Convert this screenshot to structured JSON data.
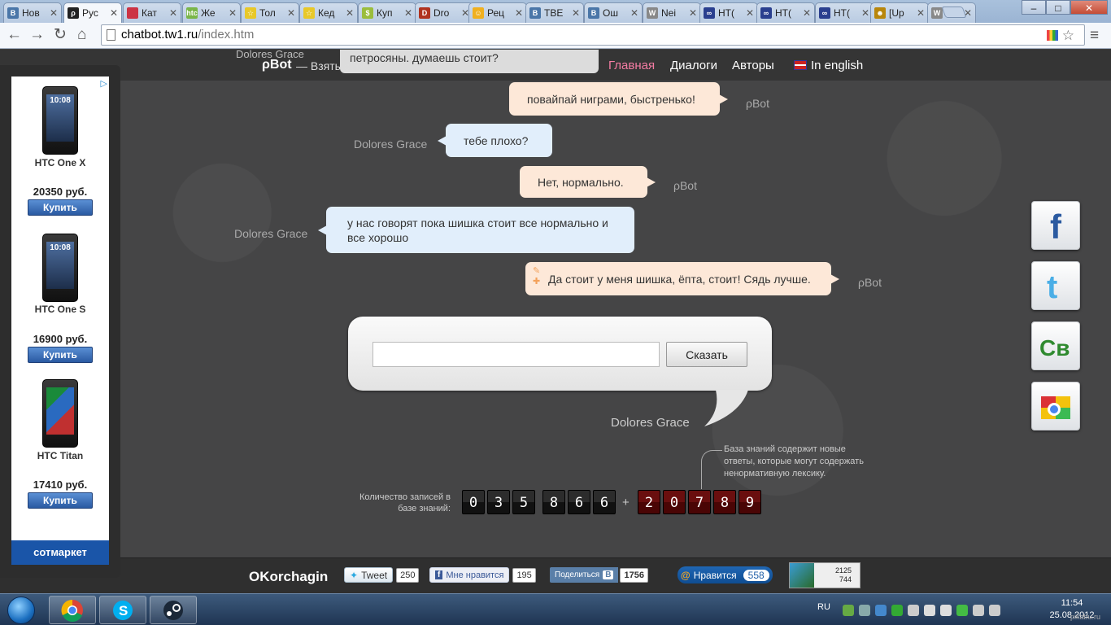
{
  "browser": {
    "tabs": [
      {
        "label": "Нов",
        "color": "#4a76a8",
        "glyph": "B"
      },
      {
        "label": "Рус",
        "color": "#222222",
        "glyph": "ρ"
      },
      {
        "label": "Кат",
        "color": "#cc3344",
        "glyph": ""
      },
      {
        "label": "Же",
        "color": "#7ab648",
        "glyph": "htc"
      },
      {
        "label": "Тол",
        "color": "#e8c829",
        "glyph": "☆"
      },
      {
        "label": "Кед",
        "color": "#e8c829",
        "glyph": "☆"
      },
      {
        "label": "Куп",
        "color": "#9bbd3c",
        "glyph": "$"
      },
      {
        "label": "Dro",
        "color": "#b0321f",
        "glyph": "D"
      },
      {
        "label": "Рец",
        "color": "#f0b020",
        "glyph": "☺"
      },
      {
        "label": "ТВЕ",
        "color": "#4a76a8",
        "glyph": "B"
      },
      {
        "label": "Ош",
        "color": "#4a76a8",
        "glyph": "B"
      },
      {
        "label": "Nei",
        "color": "#888888",
        "glyph": "W"
      },
      {
        "label": "HT(",
        "color": "#2a3f8f",
        "glyph": "∞"
      },
      {
        "label": "HT(",
        "color": "#2a3f8f",
        "glyph": "∞"
      },
      {
        "label": "HT(",
        "color": "#2a3f8f",
        "glyph": "∞"
      },
      {
        "label": "[Up",
        "color": "#b8860b",
        "glyph": "☻"
      },
      {
        "label": "Зел",
        "color": "#888888",
        "glyph": "W"
      }
    ],
    "url_host": "chatbot.tw1.ru",
    "url_path": "/index.htm"
  },
  "site": {
    "brand": "ρBot",
    "tagline": "— Взять себе!",
    "menu": [
      "Главная",
      "Диалоги",
      "Авторы"
    ],
    "english": "In english",
    "prev_message": "петросяны. думаешь стоит?",
    "prev_name": "Dolores Grace"
  },
  "chat": [
    {
      "who": "ρBot",
      "side": "bot",
      "text": "повайпай ниграми, быстренько!"
    },
    {
      "who": "Dolores Grace",
      "side": "user",
      "text": "тебе плохо?"
    },
    {
      "who": "ρBot",
      "side": "bot",
      "text": "Нет, нормально."
    },
    {
      "who": "Dolores Grace",
      "side": "user",
      "text": "у нас говорят пока шишка стоит все нормально и все хорошо"
    },
    {
      "who": "ρBot",
      "side": "bot",
      "text": "Да стоит у меня шишка, ёпта, стоит! Сядь лучше."
    }
  ],
  "input": {
    "value": "",
    "button": "Сказать",
    "user_name": "Dolores Grace"
  },
  "kb": {
    "note": "База знаний содержит новые ответы, которые могут содержать ненормативную лексику.",
    "label": "Количество записей в базе знаний:",
    "digits": [
      "0",
      "3",
      "5",
      "8",
      "6",
      "6"
    ],
    "new_digits": [
      "2",
      "0",
      "7",
      "8",
      "9"
    ],
    "plus": "+"
  },
  "social_side": [
    "facebook-icon",
    "twitter-icon",
    "sv-icon",
    "google-icon"
  ],
  "footer": {
    "brand": "OKorchagin",
    "tweet": "Tweet",
    "tweet_count": "250",
    "fb_like": "Мне нравится",
    "fb_count": "195",
    "vk_share": "Поделиться",
    "vk_count": "1756",
    "mail_like": "Нравится",
    "mail_count": "558",
    "stat1": "2125",
    "stat2": "744"
  },
  "ad": {
    "items": [
      {
        "name": "HTC One X",
        "price": "20350 руб.",
        "buy": "Купить",
        "screen": "10:08"
      },
      {
        "name": "HTC One S",
        "price": "16900 руб.",
        "buy": "Купить",
        "screen": "10:08"
      },
      {
        "name": "HTC Titan",
        "price": "17410 руб.",
        "buy": "Купить",
        "screen": ""
      }
    ],
    "logo": "сотмаркет"
  },
  "taskbar": {
    "lang": "RU",
    "time": "11:54",
    "date": "25.08.2012",
    "watermark": "pikabu.ru"
  }
}
